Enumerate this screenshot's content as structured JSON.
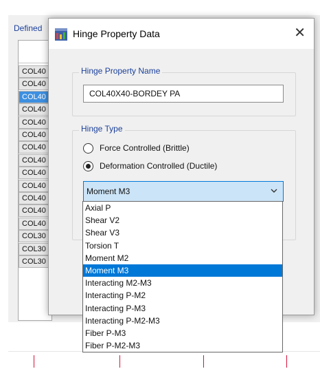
{
  "background": {
    "defined_label": "Defined",
    "list_rows": [
      {
        "label": "COL40",
        "selected": false
      },
      {
        "label": "COL40",
        "selected": false
      },
      {
        "label": "COL40",
        "selected": true
      },
      {
        "label": "COL40",
        "selected": false
      },
      {
        "label": "COL40",
        "selected": false
      },
      {
        "label": "COL40",
        "selected": false
      },
      {
        "label": "COL40",
        "selected": false
      },
      {
        "label": "COL40",
        "selected": false
      },
      {
        "label": "COL40",
        "selected": false
      },
      {
        "label": "COL40",
        "selected": false
      },
      {
        "label": "COL40",
        "selected": false
      },
      {
        "label": "COL40",
        "selected": false
      },
      {
        "label": "COL40",
        "selected": false
      },
      {
        "label": "COL30",
        "selected": false
      },
      {
        "label": "COL30",
        "selected": false
      },
      {
        "label": "COL30",
        "selected": false
      }
    ]
  },
  "dialog": {
    "title": "Hinge Property Data",
    "close_glyph": "✕",
    "name_group": {
      "label": "Hinge Property Name",
      "value": "COL40X40-BORDEY PA"
    },
    "type_group": {
      "label": "Hinge Type",
      "options": [
        {
          "label": "Force Controlled  (Brittle)",
          "checked": false
        },
        {
          "label": "Deformation Controlled  (Ductile)",
          "checked": true
        }
      ]
    },
    "combo": {
      "selected": "Moment M3",
      "options": [
        "Axial P",
        "Shear V2",
        "Shear V3",
        "Torsion T",
        "Moment M2",
        "Moment M3",
        "Interacting M2-M3",
        "Interacting P-M2",
        "Interacting P-M3",
        "Interacting P-M2-M3",
        "Fiber P-M3",
        "Fiber P-M2-M3"
      ],
      "highlighted_index": 5
    }
  },
  "colors": {
    "accent": "#0078d7",
    "combo_bg": "#cce4f7",
    "group_label": "#1a3f9a",
    "list_selected": "#3d8fe0",
    "ruler_mark": "#d8103a"
  }
}
